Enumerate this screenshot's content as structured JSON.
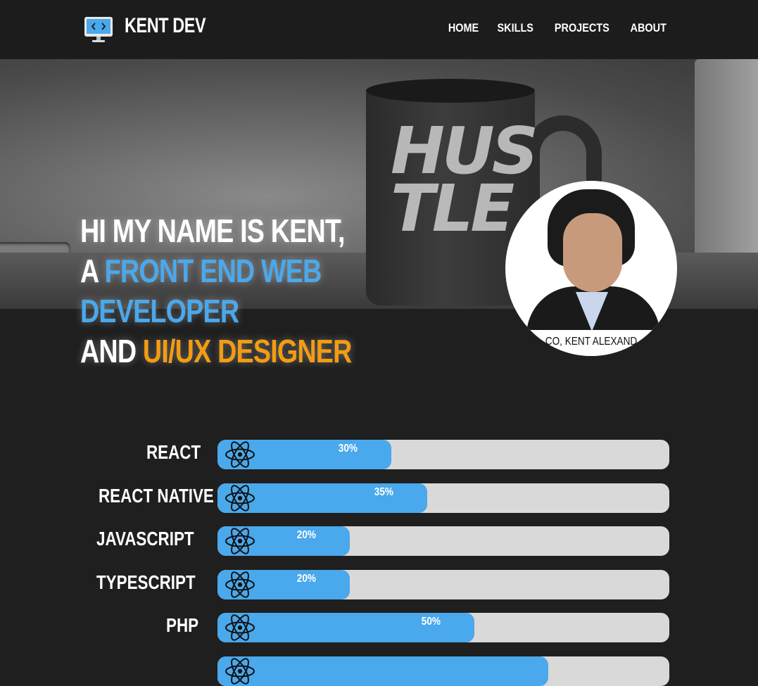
{
  "nav": {
    "logo_text": "KENT DEV",
    "links": [
      "HOME",
      "SKILLS",
      "PROJECTS",
      "ABOUT"
    ]
  },
  "hero": {
    "line1": "HI MY NAME IS KENT,",
    "line2_prefix": "A ",
    "line2_highlight": "FRONT END WEB",
    "line3_highlight": "DEVELOPER",
    "line4_prefix": "AND ",
    "line4_highlight": "UI/UX DESIGNER",
    "photo_caption": "CO, KENT ALEXAND",
    "mug_text": "HUS TLE"
  },
  "colors": {
    "accent_blue": "#4aa8ec",
    "accent_orange": "#f39c12",
    "background": "#1f1f1f",
    "track": "#d9d9d9"
  },
  "skills": [
    {
      "name": "REACT",
      "percent_label": "30%",
      "percent": 30,
      "icon": "react-atom-icon"
    },
    {
      "name": "REACT NATIVE",
      "percent_label": "35%",
      "percent": 35,
      "icon": "react-atom-icon"
    },
    {
      "name": "JAVASCRIPT",
      "percent_label": "20%",
      "percent": 20,
      "icon": "react-atom-icon"
    },
    {
      "name": "TYPESCRIPT",
      "percent_label": "20%",
      "percent": 20,
      "icon": "react-atom-icon"
    },
    {
      "name": "PHP",
      "percent_label": "50%",
      "percent": 50,
      "icon": "react-atom-icon"
    },
    {
      "name": "",
      "percent_label": "",
      "percent": 67,
      "icon": "react-atom-icon"
    }
  ]
}
